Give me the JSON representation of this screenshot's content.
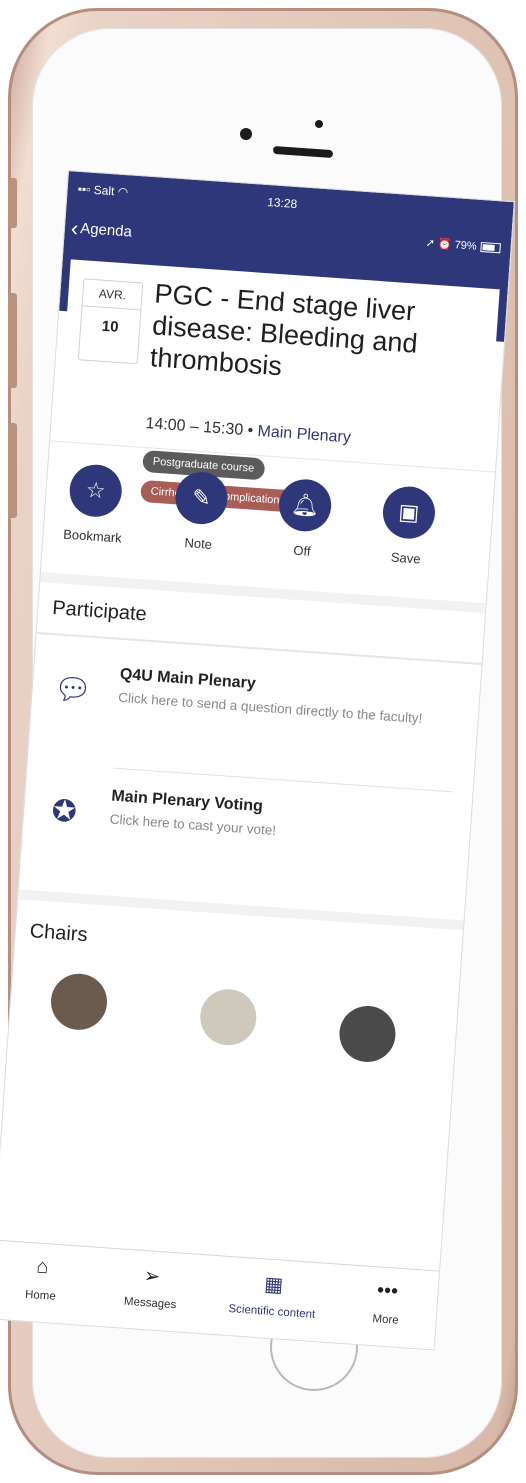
{
  "status": {
    "carrier": "Salt",
    "time": "13:28",
    "battery": "79%"
  },
  "nav": {
    "back_label": "Agenda"
  },
  "session": {
    "month": "AVR.",
    "day": "10",
    "title": "PGC - End stage liver disease: Bleeding and thrombosis",
    "time_range": "14:00 – 15:30",
    "separator": "•",
    "room": "Main Plenary",
    "tags": [
      "Postgraduate course",
      "Cirrhosis and complications"
    ]
  },
  "actions": {
    "bookmark": "Bookmark",
    "note": "Note",
    "alert": "Off",
    "save": "Save"
  },
  "participate": {
    "title": "Participate",
    "items": [
      {
        "title": "Q4U Main Plenary",
        "subtitle": "Click here to send a question directly to the faculty!"
      },
      {
        "title": "Main Plenary Voting",
        "subtitle": "Click here to cast your vote!"
      }
    ]
  },
  "chairs": {
    "title": "Chairs"
  },
  "tabbar": {
    "home": "Home",
    "messages": "Messages",
    "scientific": "Scientific content",
    "more": "More"
  },
  "colors": {
    "primary": "#2e3779",
    "tag_grey": "#5b5b5b",
    "tag_red": "#a85e56"
  },
  "icons": [
    "star-icon",
    "note-icon",
    "bell-icon",
    "calendar-icon",
    "question-chat-icon",
    "star-badge-icon",
    "home-icon",
    "paper-plane-icon",
    "grid-icon",
    "more-icon"
  ]
}
